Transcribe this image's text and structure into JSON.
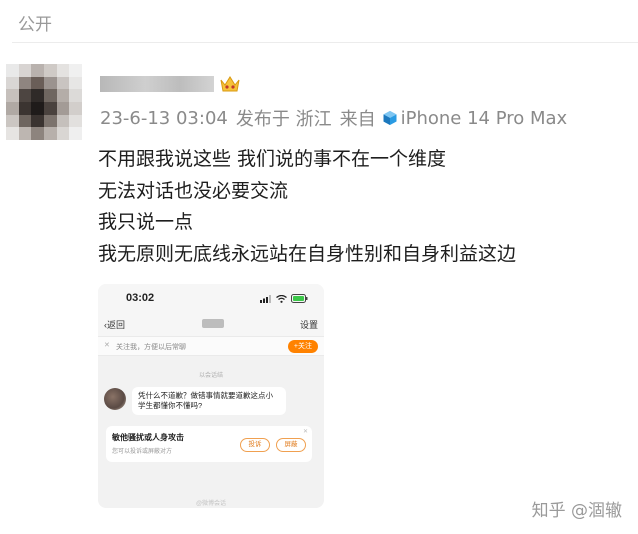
{
  "post": {
    "visibility_label": "公开",
    "author": {
      "avatar": "pixelated-avatar",
      "username": "",
      "badge": "vip-crown-icon"
    },
    "meta": {
      "date_time": "23-6-13 03:04",
      "location": "发布于 浙江",
      "source_prefix": "来自",
      "device_icon": "cube-icon",
      "device_name": "iPhone 14 Pro Max"
    },
    "body_lines": [
      "不用跟我说这些 我们说的事不在一个维度",
      "无法对话也没必要交流",
      "我只说一点",
      "我无原则无底线永远站在自身性别和自身利益这边"
    ],
    "image": {
      "status_time": "03:02",
      "back_label": "返回",
      "settings_label": "设置",
      "follow_hint": "关注我，方便以后常聊",
      "follow_button": "+关注",
      "system_notice": "以会话结",
      "message": "凭什么不道歉？做错事情就要道歉这点小学生都懂你不懂吗?",
      "warning_title": "敏他骚扰或人身攻击",
      "warning_subtitle": "您可以投诉或屏蔽对方",
      "report_button": "投诉",
      "block_button": "屏蔽",
      "bottom_hint": "@微博会话"
    }
  },
  "watermark": "知乎 @涸辙",
  "colors": {
    "meta_text": "#8a8a8a",
    "follow_orange": "#ff8200",
    "device_icon_blue": "#1c8fd6"
  }
}
